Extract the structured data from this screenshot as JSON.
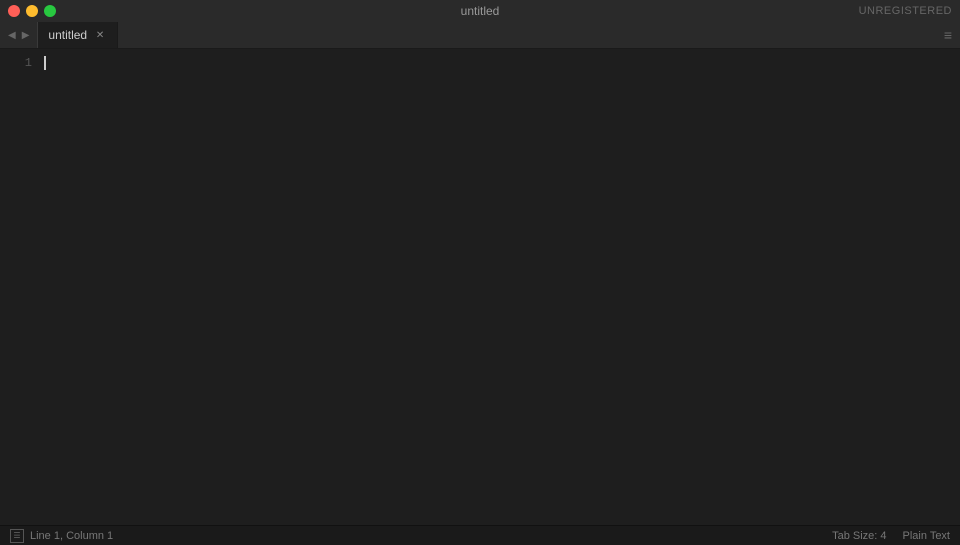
{
  "titleBar": {
    "title": "untitled",
    "unregistered": "UNREGISTERED"
  },
  "tabBar": {
    "tab": {
      "name": "untitled",
      "closeIcon": "✕"
    },
    "settingsIcon": "≡",
    "arrowLeft": "◀",
    "arrowRight": "▶"
  },
  "editor": {
    "lineNumbers": [
      "1"
    ],
    "cursorChar": ""
  },
  "statusBar": {
    "position": "Line 1, Column 1",
    "tabSize": "Tab Size: 4",
    "fileType": "Plain Text"
  }
}
